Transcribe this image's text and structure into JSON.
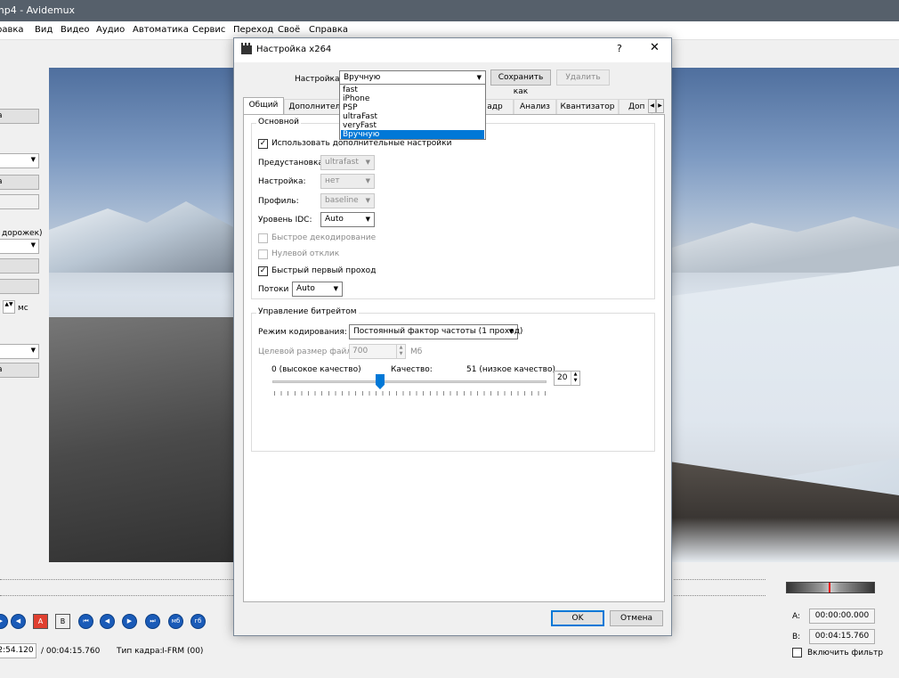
{
  "app": {
    "title": "mp4 - Avidemux",
    "menu": [
      "равка",
      "Вид",
      "Видео",
      "Аудио",
      "Автоматика",
      "Сервис",
      "Переход",
      "Своё",
      "Справка"
    ]
  },
  "left_panel": {
    "button1": "а",
    "button2": "а",
    "audio_tracks_label": "дорожек)",
    "ms_label": "мс",
    "button3": "а"
  },
  "bottom": {
    "current_time": "2:54.120",
    "total_time": "/ 00:04:15.760",
    "frame_type_label": "Тип кадра:",
    "frame_type_value": "I-FRM (00)",
    "a_label": "A:",
    "a_value": "00:00:00.000",
    "b_label": "B:",
    "b_value": "00:04:15.760",
    "filter_label": "Включить фильтр",
    "btn_ab_a": "A",
    "btn_ab_b": "B",
    "btn_mb": "мб",
    "btn_gb": "гб"
  },
  "dialog": {
    "title": "Настройка x264",
    "help": "?",
    "close": "✕",
    "preset_label": "Настройка",
    "preset_value": "Вручную",
    "save_as": "Сохранить как",
    "delete": "Удалить",
    "dropdown_items": [
      "fast",
      "iPhone",
      "PSP",
      "ultraFast",
      "veryFast",
      "Вручную"
    ],
    "dropdown_selected": 5,
    "tabs": [
      "Общий",
      "Дополнитель",
      "адр",
      "Анализ",
      "Квантизатор",
      "Доп"
    ],
    "group_basic": "Основной",
    "use_advanced": "Использовать дополнительные настройки",
    "preset_lbl": "Предустановка:",
    "preset_val": "ultrafast",
    "tuning_lbl": "Настройка:",
    "tuning_val": "нет",
    "profile_lbl": "Профиль:",
    "profile_val": "baseline",
    "idc_lbl": "Уровень IDC:",
    "idc_val": "Auto",
    "fast_decode": "Быстрое декодирование",
    "zero_latency": "Нулевой отклик",
    "fast_first_pass": "Быстрый первый проход",
    "threads_lbl": "Потоки",
    "threads_val": "Auto",
    "group_bitrate": "Управление битрейтом",
    "mode_lbl": "Режим кодирования:",
    "mode_val": "Постоянный фактор частоты (1 проход)",
    "size_lbl": "Целевой размер файла:",
    "size_val": "700",
    "size_unit": "Мб",
    "q_low": "0 (высокое качество)",
    "q_label": "Качество:",
    "q_high": "51 (низкое качество)",
    "q_value": "20",
    "quality_level": 20,
    "quality_max": 51,
    "ok": "OK",
    "cancel": "Отмена"
  }
}
